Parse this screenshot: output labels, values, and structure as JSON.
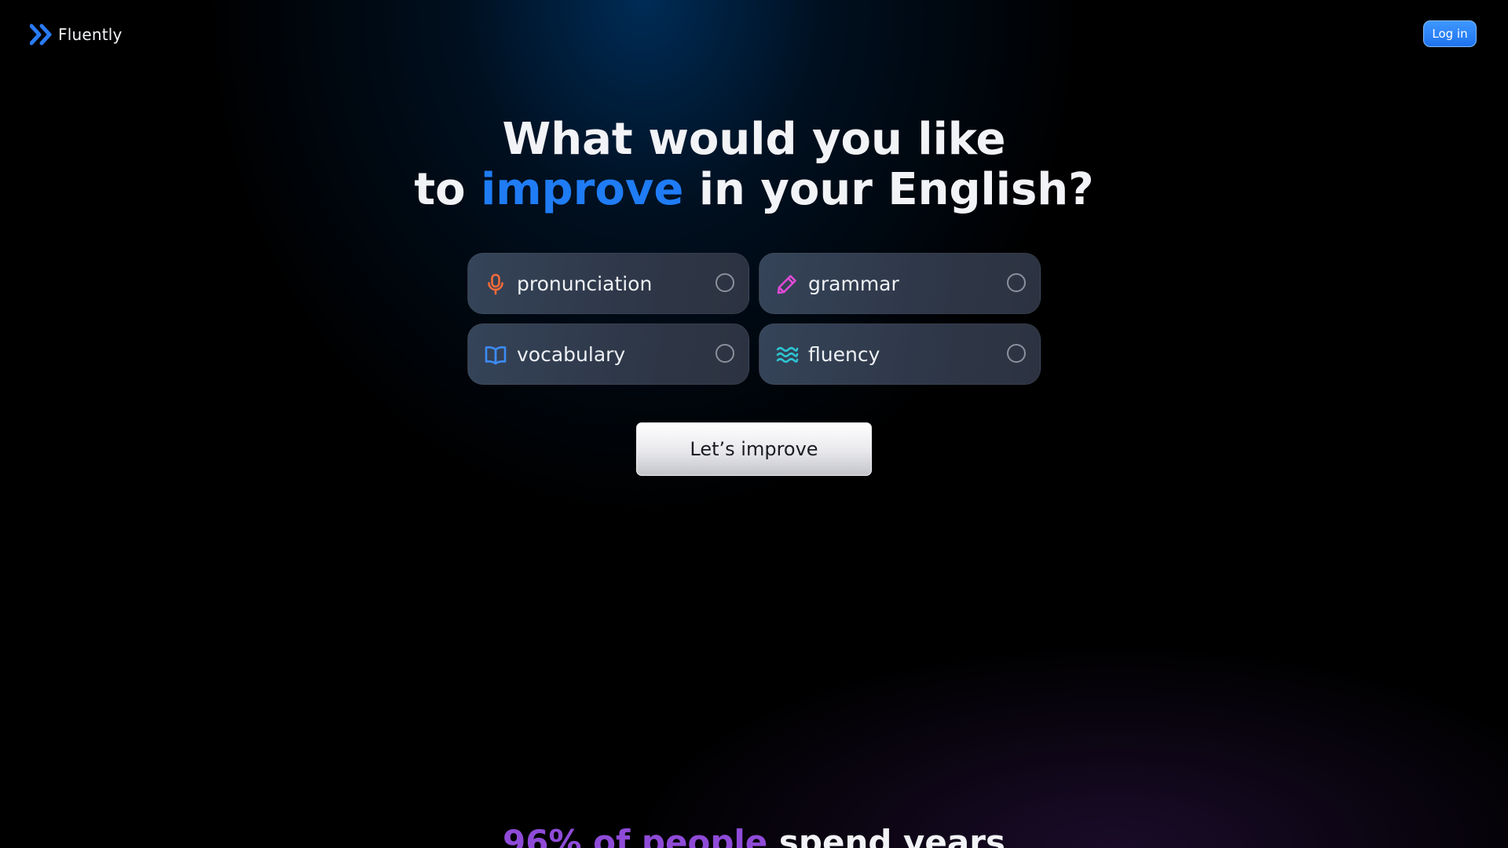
{
  "brand": {
    "name": "Fluently",
    "logo_icon": "double-chevron-right-icon",
    "logo_color": "#2a7bf4"
  },
  "nav": {
    "login_label": "Log in"
  },
  "hero": {
    "headline_line1": "What would you like",
    "headline_prefix": "to",
    "headline_accent": "improve",
    "headline_suffix": "in your English?",
    "accent_color": "#1f7cf5"
  },
  "options": [
    {
      "label": "pronunciation",
      "icon": "microphone-icon",
      "icon_color": "#f26b3a",
      "selected": false
    },
    {
      "label": "grammar",
      "icon": "pencil-icon",
      "icon_color": "#e24ad6",
      "selected": false
    },
    {
      "label": "vocabulary",
      "icon": "open-book-icon",
      "icon_color": "#3d8bf5",
      "selected": false
    },
    {
      "label": "fluency",
      "icon": "waves-icon",
      "icon_color": "#2ec4d2",
      "selected": false
    }
  ],
  "cta": {
    "label": "Let’s improve"
  },
  "stats": {
    "accent_text": "96% of people",
    "rest_text": "spend years",
    "accent_color": "#8f4bd8"
  }
}
